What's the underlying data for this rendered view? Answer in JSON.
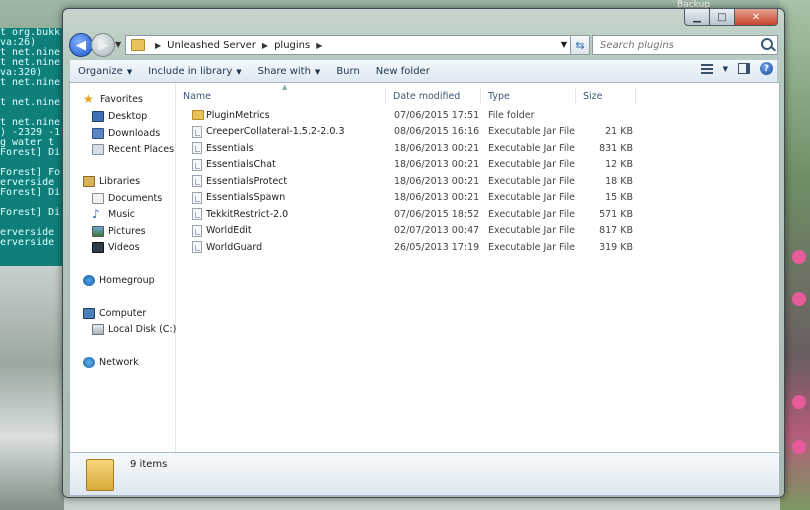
{
  "background": {
    "console_lines": [
      "t org.bukk",
      "va:26)",
      "t net.nine",
      "t net.nine",
      "va:320)",
      "t net.nine",
      "",
      "t net.nine",
      "",
      "t net.nine",
      ") -2329 -1",
      "g water t",
      "Forest] Di",
      "",
      "Forest] Fo",
      "erverside",
      "Forest] Di",
      "",
      "Forest] Di",
      "",
      "erverside",
      "erverside"
    ],
    "other_window_title": "Backup"
  },
  "window": {
    "caption": {
      "minimize": "▁",
      "maximize": "□",
      "close": "✕"
    },
    "address": {
      "crumbs": [
        "Unleashed Server",
        "plugins"
      ]
    },
    "search": {
      "placeholder": "Search plugins"
    },
    "toolbar": {
      "organize": "Organize",
      "include_in_library": "Include in library",
      "share_with": "Share with",
      "burn": "Burn",
      "new_folder": "New folder",
      "help": "?"
    },
    "nav": {
      "favorites": "Favorites",
      "desktop": "Desktop",
      "downloads": "Downloads",
      "recent_places": "Recent Places",
      "libraries": "Libraries",
      "documents": "Documents",
      "music": "Music",
      "pictures": "Pictures",
      "videos": "Videos",
      "homegroup": "Homegroup",
      "computer": "Computer",
      "local_disk": "Local Disk (C:)",
      "network": "Network"
    },
    "columns": {
      "name": "Name",
      "date": "Date modified",
      "type": "Type",
      "size": "Size"
    },
    "files": [
      {
        "name": "PluginMetrics",
        "date": "07/06/2015 17:51",
        "type": "File folder",
        "size": "",
        "kind": "folder"
      },
      {
        "name": "CreeperCollateral-1.5.2-2.0.3",
        "date": "08/06/2015 16:16",
        "type": "Executable Jar File",
        "size": "21 KB",
        "kind": "file"
      },
      {
        "name": "Essentials",
        "date": "18/06/2013 00:21",
        "type": "Executable Jar File",
        "size": "831 KB",
        "kind": "file"
      },
      {
        "name": "EssentialsChat",
        "date": "18/06/2013 00:21",
        "type": "Executable Jar File",
        "size": "12 KB",
        "kind": "file"
      },
      {
        "name": "EssentialsProtect",
        "date": "18/06/2013 00:21",
        "type": "Executable Jar File",
        "size": "18 KB",
        "kind": "file"
      },
      {
        "name": "EssentialsSpawn",
        "date": "18/06/2013 00:21",
        "type": "Executable Jar File",
        "size": "15 KB",
        "kind": "file"
      },
      {
        "name": "TekkitRestrict-2.0",
        "date": "07/06/2015 18:52",
        "type": "Executable Jar File",
        "size": "571 KB",
        "kind": "file"
      },
      {
        "name": "WorldEdit",
        "date": "02/07/2013 00:47",
        "type": "Executable Jar File",
        "size": "817 KB",
        "kind": "file"
      },
      {
        "name": "WorldGuard",
        "date": "26/05/2013 17:19",
        "type": "Executable Jar File",
        "size": "319 KB",
        "kind": "file"
      }
    ],
    "status": {
      "item_count": "9 items"
    }
  }
}
